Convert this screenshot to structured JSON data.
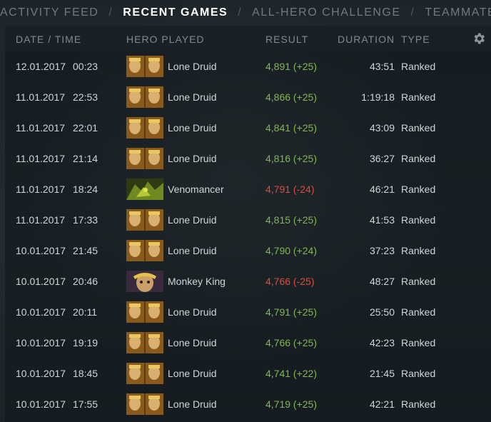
{
  "nav": {
    "tabs": [
      "ACTIVITY FEED",
      "RECENT GAMES",
      "ALL-HERO CHALLENGE",
      "TEAMMATES"
    ],
    "active": "RECENT GAMES",
    "separator": "/"
  },
  "table": {
    "headers": {
      "datetime": "DATE / TIME",
      "hero": "HERO PLAYED",
      "result": "RESULT",
      "duration": "DURATION",
      "type": "TYPE"
    },
    "settings_icon": "gear-icon",
    "rows": [
      {
        "date": "12.01.2017",
        "time": "00:23",
        "hero": "Lone Druid",
        "hero_icon": "lone-druid",
        "result": "4,891 (+25)",
        "outcome": "win",
        "duration": "43:51",
        "type": "Ranked"
      },
      {
        "date": "11.01.2017",
        "time": "22:53",
        "hero": "Lone Druid",
        "hero_icon": "lone-druid",
        "result": "4,866 (+25)",
        "outcome": "win",
        "duration": "1:19:18",
        "type": "Ranked"
      },
      {
        "date": "11.01.2017",
        "time": "22:01",
        "hero": "Lone Druid",
        "hero_icon": "lone-druid",
        "result": "4,841 (+25)",
        "outcome": "win",
        "duration": "43:09",
        "type": "Ranked"
      },
      {
        "date": "11.01.2017",
        "time": "21:14",
        "hero": "Lone Druid",
        "hero_icon": "lone-druid",
        "result": "4,816 (+25)",
        "outcome": "win",
        "duration": "36:27",
        "type": "Ranked"
      },
      {
        "date": "11.01.2017",
        "time": "18:24",
        "hero": "Venomancer",
        "hero_icon": "venomancer",
        "result": "4,791 (-24)",
        "outcome": "loss",
        "duration": "46:21",
        "type": "Ranked"
      },
      {
        "date": "11.01.2017",
        "time": "17:33",
        "hero": "Lone Druid",
        "hero_icon": "lone-druid",
        "result": "4,815 (+25)",
        "outcome": "win",
        "duration": "41:53",
        "type": "Ranked"
      },
      {
        "date": "10.01.2017",
        "time": "21:45",
        "hero": "Lone Druid",
        "hero_icon": "lone-druid",
        "result": "4,790 (+24)",
        "outcome": "win",
        "duration": "37:23",
        "type": "Ranked"
      },
      {
        "date": "10.01.2017",
        "time": "20:46",
        "hero": "Monkey King",
        "hero_icon": "monkey-king",
        "result": "4,766 (-25)",
        "outcome": "loss",
        "duration": "48:27",
        "type": "Ranked"
      },
      {
        "date": "10.01.2017",
        "time": "20:11",
        "hero": "Lone Druid",
        "hero_icon": "lone-druid",
        "result": "4,791 (+25)",
        "outcome": "win",
        "duration": "25:50",
        "type": "Ranked"
      },
      {
        "date": "10.01.2017",
        "time": "19:19",
        "hero": "Lone Druid",
        "hero_icon": "lone-druid",
        "result": "4,766 (+25)",
        "outcome": "win",
        "duration": "42:23",
        "type": "Ranked"
      },
      {
        "date": "10.01.2017",
        "time": "18:45",
        "hero": "Lone Druid",
        "hero_icon": "lone-druid",
        "result": "4,741 (+22)",
        "outcome": "win",
        "duration": "21:45",
        "type": "Ranked"
      },
      {
        "date": "10.01.2017",
        "time": "17:55",
        "hero": "Lone Druid",
        "hero_icon": "lone-druid",
        "result": "4,719 (+25)",
        "outcome": "win",
        "duration": "42:21",
        "type": "Ranked"
      }
    ]
  },
  "colors": {
    "win": "#7fb84e",
    "loss": "#dd4a3c",
    "active_tab": "#ffffff",
    "inactive_tab": "#6f7a80"
  }
}
